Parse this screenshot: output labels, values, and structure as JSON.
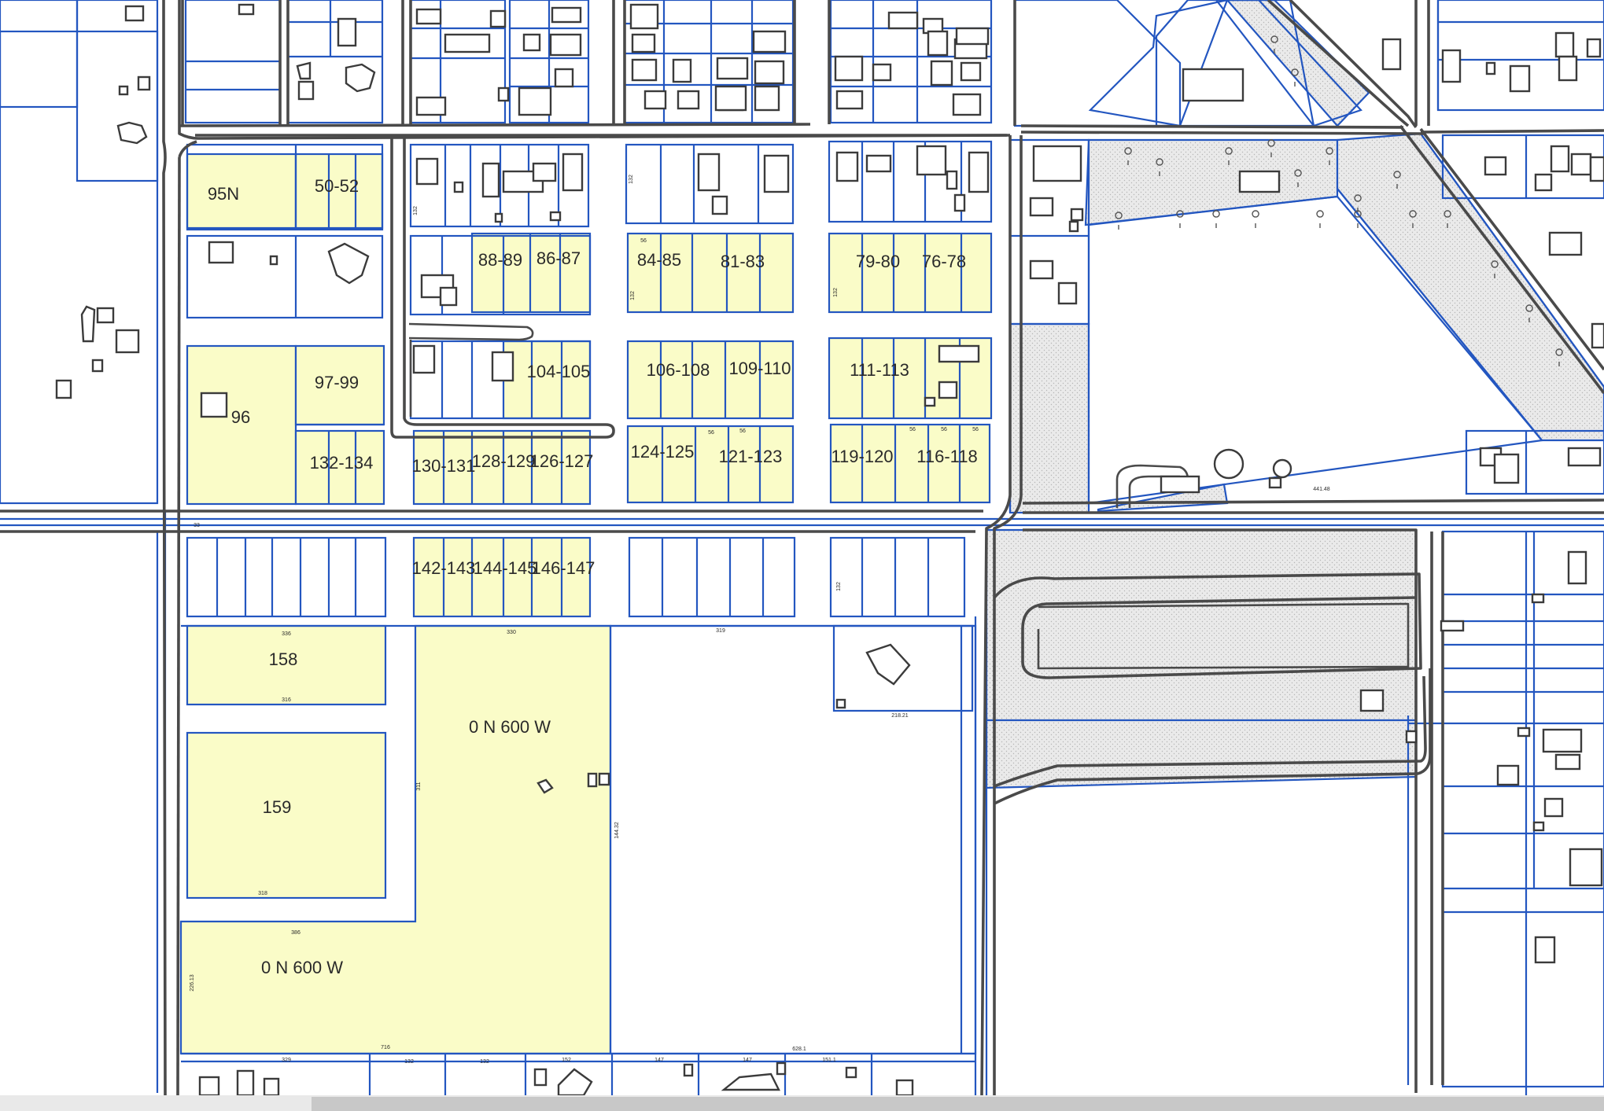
{
  "map": {
    "parcel_labels": [
      "95N",
      "50-52",
      "88-89",
      "86-87",
      "84-85",
      "81-83",
      "79-80",
      "76-78",
      "97-99",
      "96",
      "104-105",
      "106-108",
      "109-110",
      "111-113",
      "132-134",
      "130-131",
      "128-129",
      "126-127",
      "124-125",
      "121-123",
      "119-120",
      "116-118",
      "142-143",
      "144-145",
      "146-147",
      "158",
      "159",
      "0 N 600 W",
      "0 N 600 W"
    ],
    "dimension_labels": [
      "336",
      "316",
      "330",
      "319",
      "318",
      "386",
      "311",
      "716",
      "628.1",
      "144.32",
      "218.21",
      "329",
      "132",
      "132",
      "152",
      "147",
      "147",
      "151.1",
      "226.13",
      "33",
      "132",
      "132",
      "132",
      "132",
      "132",
      "56",
      "56",
      "56",
      "56",
      "56",
      "56",
      "441.48"
    ],
    "colors": {
      "parcel_line": "#2356c0",
      "road_line": "#4a4a4a",
      "highlighted_parcel": "#fafcc8",
      "shaded_area": "#e4e4e4"
    }
  },
  "scrollbar": {
    "orientation": "horizontal",
    "visible_fraction": 0.806
  }
}
